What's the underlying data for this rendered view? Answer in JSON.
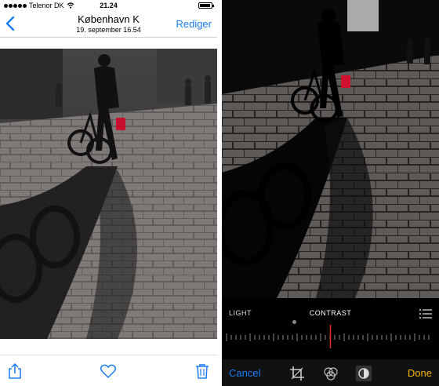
{
  "status": {
    "carrier": "Telenor DK",
    "time": "21.24",
    "battery_level": 0.9
  },
  "nav": {
    "title": "København K",
    "subtitle": "19. september  16.54",
    "edit_label": "Rediger",
    "back_icon": "chevron-left-icon"
  },
  "photo_toolbar": {
    "icons": [
      "share-icon",
      "heart-icon",
      "trash-icon"
    ]
  },
  "editor": {
    "adjust_left": "LIGHT",
    "adjust_center": "CONTRAST",
    "list_icon": "list-icon",
    "cancel_label": "Cancel",
    "done_label": "Done",
    "tool_icons": [
      "crop-icon",
      "filters-icon",
      "adjust-icon"
    ]
  },
  "colors": {
    "accent_blue": "#1a7cf5",
    "done_yellow": "#f5b400",
    "slider_indicator": "#e0302a"
  }
}
